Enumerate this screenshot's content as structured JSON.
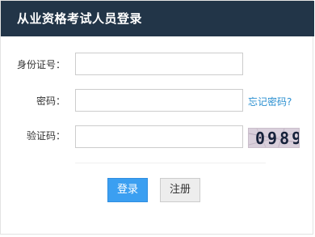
{
  "header": {
    "title": "从业资格考试人员登录"
  },
  "form": {
    "id_label": "身份证号：",
    "id_value": "",
    "password_label": "密码：",
    "password_value": "",
    "forgot_password_link": "忘记密码?",
    "captcha_label": "验证码：",
    "captcha_value": "",
    "captcha_image_text": "0989"
  },
  "buttons": {
    "login_label": "登录",
    "register_label": "注册"
  },
  "colors": {
    "header_bg": "#223548",
    "login_button": "#3b9ff1",
    "link": "#2a8fd0"
  }
}
